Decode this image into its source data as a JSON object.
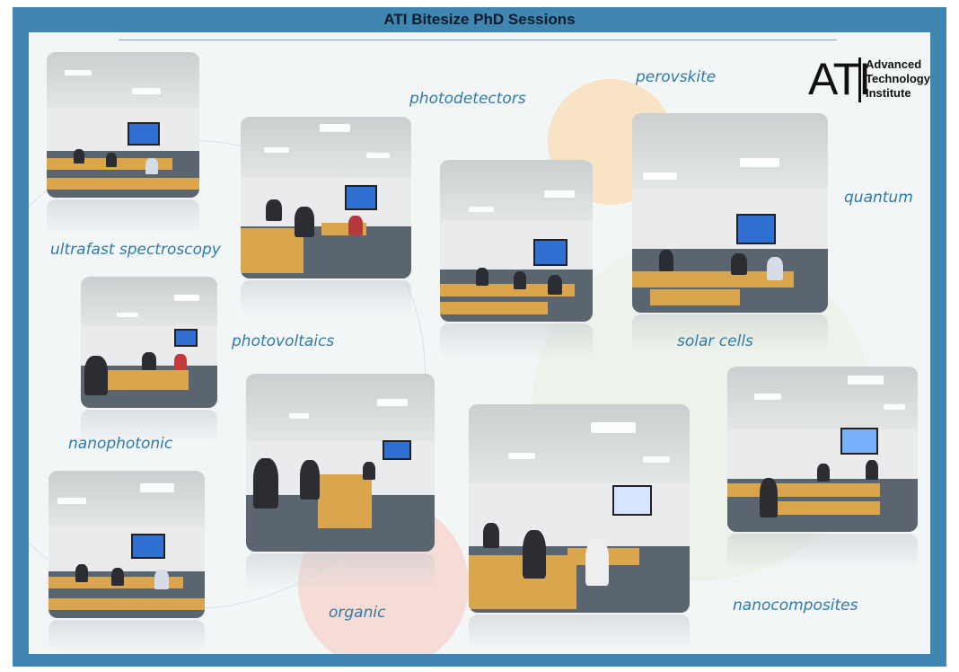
{
  "header": {
    "title": "ATI Bitesize PhD Sessions"
  },
  "logo": {
    "mark": "ATI",
    "line1": "Advanced",
    "line2": "Technology",
    "line3": "Institute"
  },
  "labels": {
    "ultrafast": "ultrafast spectroscopy",
    "photodetectors": "photodetectors",
    "perovskite": "perovskite",
    "quantum": "quantum",
    "photovoltaics": "photovoltaics",
    "solar": "solar cells",
    "nanophotonic": "nanophotonic",
    "organic": "organic",
    "nanocomposites": "nanocomposites"
  },
  "photos": [
    {
      "name": "session-photo-1"
    },
    {
      "name": "session-photo-2"
    },
    {
      "name": "session-photo-3"
    },
    {
      "name": "session-photo-4"
    },
    {
      "name": "session-photo-5"
    },
    {
      "name": "session-photo-6"
    },
    {
      "name": "session-photo-7"
    },
    {
      "name": "session-photo-8"
    },
    {
      "name": "session-photo-9"
    }
  ],
  "colors": {
    "frame": "#3f86b3",
    "label": "#2f7aa8",
    "desk": "#d9a54d",
    "screen": "#2f6fd1"
  }
}
